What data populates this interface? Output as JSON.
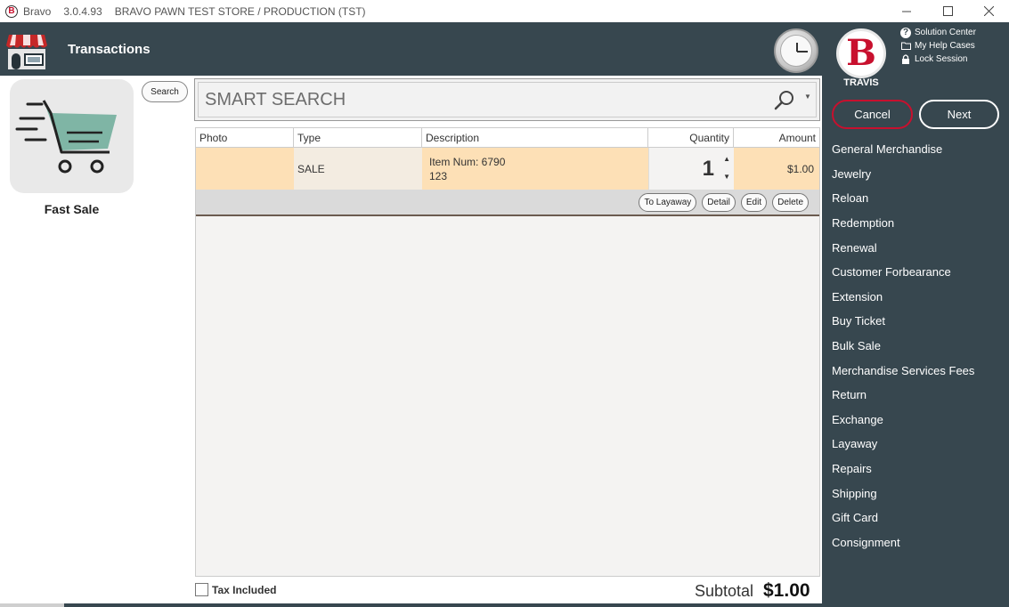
{
  "titlebar": {
    "app_name": "Bravo",
    "version": "3.0.4.93",
    "store": "BRAVO PAWN TEST STORE / PRODUCTION (TST)",
    "logo_letter": "B"
  },
  "header": {
    "title": "Transactions"
  },
  "user": {
    "name": "TRAVIS",
    "logo_letter": "B"
  },
  "top_links": {
    "solution_center": "Solution Center",
    "help_cases": "My Help Cases",
    "lock_session": "Lock Session"
  },
  "actions": {
    "cancel": "Cancel",
    "next": "Next"
  },
  "menu": [
    "General Merchandise",
    "Jewelry",
    "Reloan",
    "Redemption",
    "Renewal",
    "Customer Forbearance",
    "Extension",
    "Buy Ticket",
    "Bulk Sale",
    "Merchandise Services Fees",
    "Return",
    "Exchange",
    "Layaway",
    "Repairs",
    "Shipping",
    "Gift Card",
    "Consignment"
  ],
  "left": {
    "tile_label": "Fast Sale",
    "search_button": "Search"
  },
  "smart_search": {
    "placeholder": "SMART SEARCH"
  },
  "grid": {
    "columns": [
      "Photo",
      "Type",
      "Description",
      "Quantity",
      "Amount"
    ],
    "rows": [
      {
        "photo": "",
        "type": "SALE",
        "desc_line1": "Item Num: 6790",
        "desc_line2": "123",
        "quantity": "1",
        "amount": "$1.00"
      }
    ],
    "row_actions": [
      "To Layaway",
      "Detail",
      "Edit",
      "Delete"
    ]
  },
  "footer": {
    "tax_included": "Tax Included",
    "subtotal_label": "Subtotal",
    "subtotal_value": "$1.00"
  },
  "colors": {
    "header_bg": "#37474f",
    "cancel_border": "#c8102e",
    "row_highlight": "#fde0b6",
    "cart_accent": "#7fb5a5"
  }
}
